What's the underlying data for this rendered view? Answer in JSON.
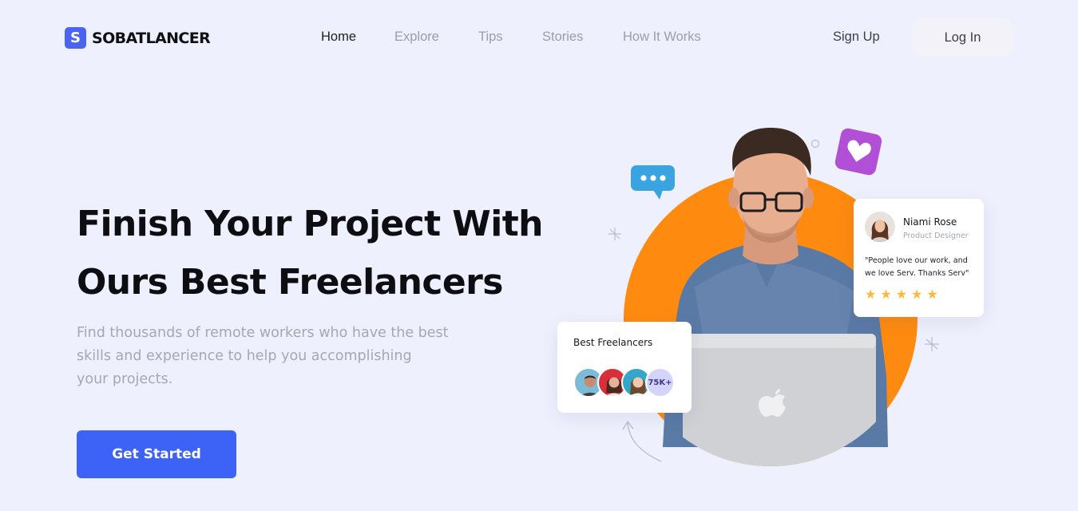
{
  "header": {
    "logo_letter": "S",
    "logo_text": "SOBATLANCER",
    "nav": [
      {
        "label": "Home",
        "active": true
      },
      {
        "label": "Explore",
        "active": false
      },
      {
        "label": "Tips",
        "active": false
      },
      {
        "label": "Stories",
        "active": false
      },
      {
        "label": "How It Works",
        "active": false
      }
    ],
    "signup_label": "Sign Up",
    "login_label": "Log In"
  },
  "hero": {
    "title_line1": "Finish Your Project With",
    "title_line2": "Ours Best Freelancers",
    "subtitle_line1": "Find thousands of remote workers who have the best",
    "subtitle_line2": "skills and experience to help you accomplishing",
    "subtitle_line3": "your projects.",
    "cta_label": "Get Started"
  },
  "best_freelancers_card": {
    "title": "Best Freelancers",
    "count": "75K+"
  },
  "review_card": {
    "name": "Niami Rose",
    "role": "Product Designer",
    "quote": "\"People love our work, and we love Serv. Thanks Serv\"",
    "rating": 5,
    "stars": [
      "★",
      "★",
      "★",
      "★",
      "★"
    ]
  },
  "colors": {
    "background": "#eef0fd",
    "primary": "#3c63f6",
    "orange_circle": "#ff8a10",
    "chat_bubble": "#3aa4e0",
    "heart_tile": "#b14fd6",
    "star": "#ffba35"
  },
  "icons": {
    "logo": "dollar-s-icon",
    "chat": "chat-bubble-icon",
    "heart": "heart-icon",
    "laptop_logo": "apple-icon"
  }
}
